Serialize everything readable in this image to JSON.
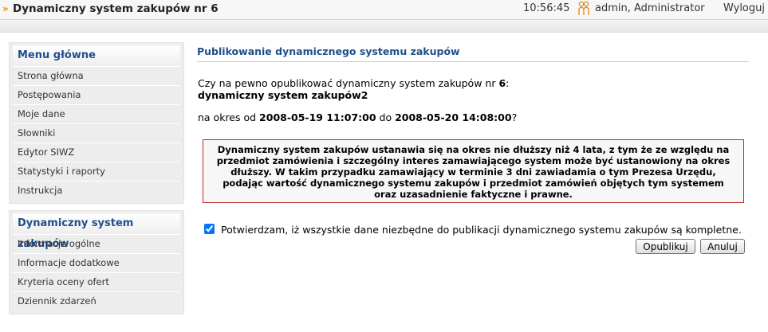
{
  "header": {
    "title": "Dynamiczny system zakupów nr 6",
    "time": "10:56:45",
    "user": "admin, Administrator",
    "logout": "Wyloguj"
  },
  "main_menu": {
    "title": "Menu główne",
    "items": [
      "Strona główna",
      "Postępowania",
      "Moje dane",
      "Słowniki",
      "Edytor SIWZ",
      "Statystyki i raporty",
      "Instrukcja"
    ]
  },
  "dsz_menu": {
    "title": "Dynamiczny system zakupów",
    "items": [
      "Informacje ogólne",
      "Informacje dodatkowe",
      "Kryteria oceny ofert",
      "Dziennik zdarzeń"
    ]
  },
  "main": {
    "heading": "Publikowanie dynamicznego systemu zakupów",
    "question_prefix": "Czy na pewno opublikować dynamiczny system zakupów nr ",
    "system_number": "6",
    "question_suffix": ":",
    "system_name": "dynamiczny system zakupów2",
    "period_prefix": "na okres od ",
    "date_from": "2008-05-19 11:07:00",
    "period_mid": " do ",
    "date_to": "2008-05-20 14:08:00",
    "period_suffix": "?",
    "warning": "Dynamiczny system zakupów ustanawia się na okres nie dłuższy niż 4 lata, z tym że ze względu na przedmiot zamówienia i szczególny interes zamawiającego system może być ustanowiony na okres dłuższy. W takim przypadku zamawiający w terminie 3 dni zawiadamia o tym Prezesa Urzędu, podając wartość dynamicznego systemu zakupów i przedmiot zamówień objętych tym systemem oraz uzasadnienie faktyczne i prawne.",
    "confirm_label": "Potwierdzam, iż wszystkie dane niezbędne do publikacji dynamicznego systemu zakupów są kompletne.",
    "publish_label": "Opublikuj",
    "cancel_label": "Anuluj"
  },
  "icons": {
    "header_chevron": "double-chevron-right-icon",
    "user": "users-icon"
  },
  "colors": {
    "accent_orange": "#f08a00",
    "heading_blue": "#1f4e8c",
    "warning_border": "#c3262c"
  }
}
